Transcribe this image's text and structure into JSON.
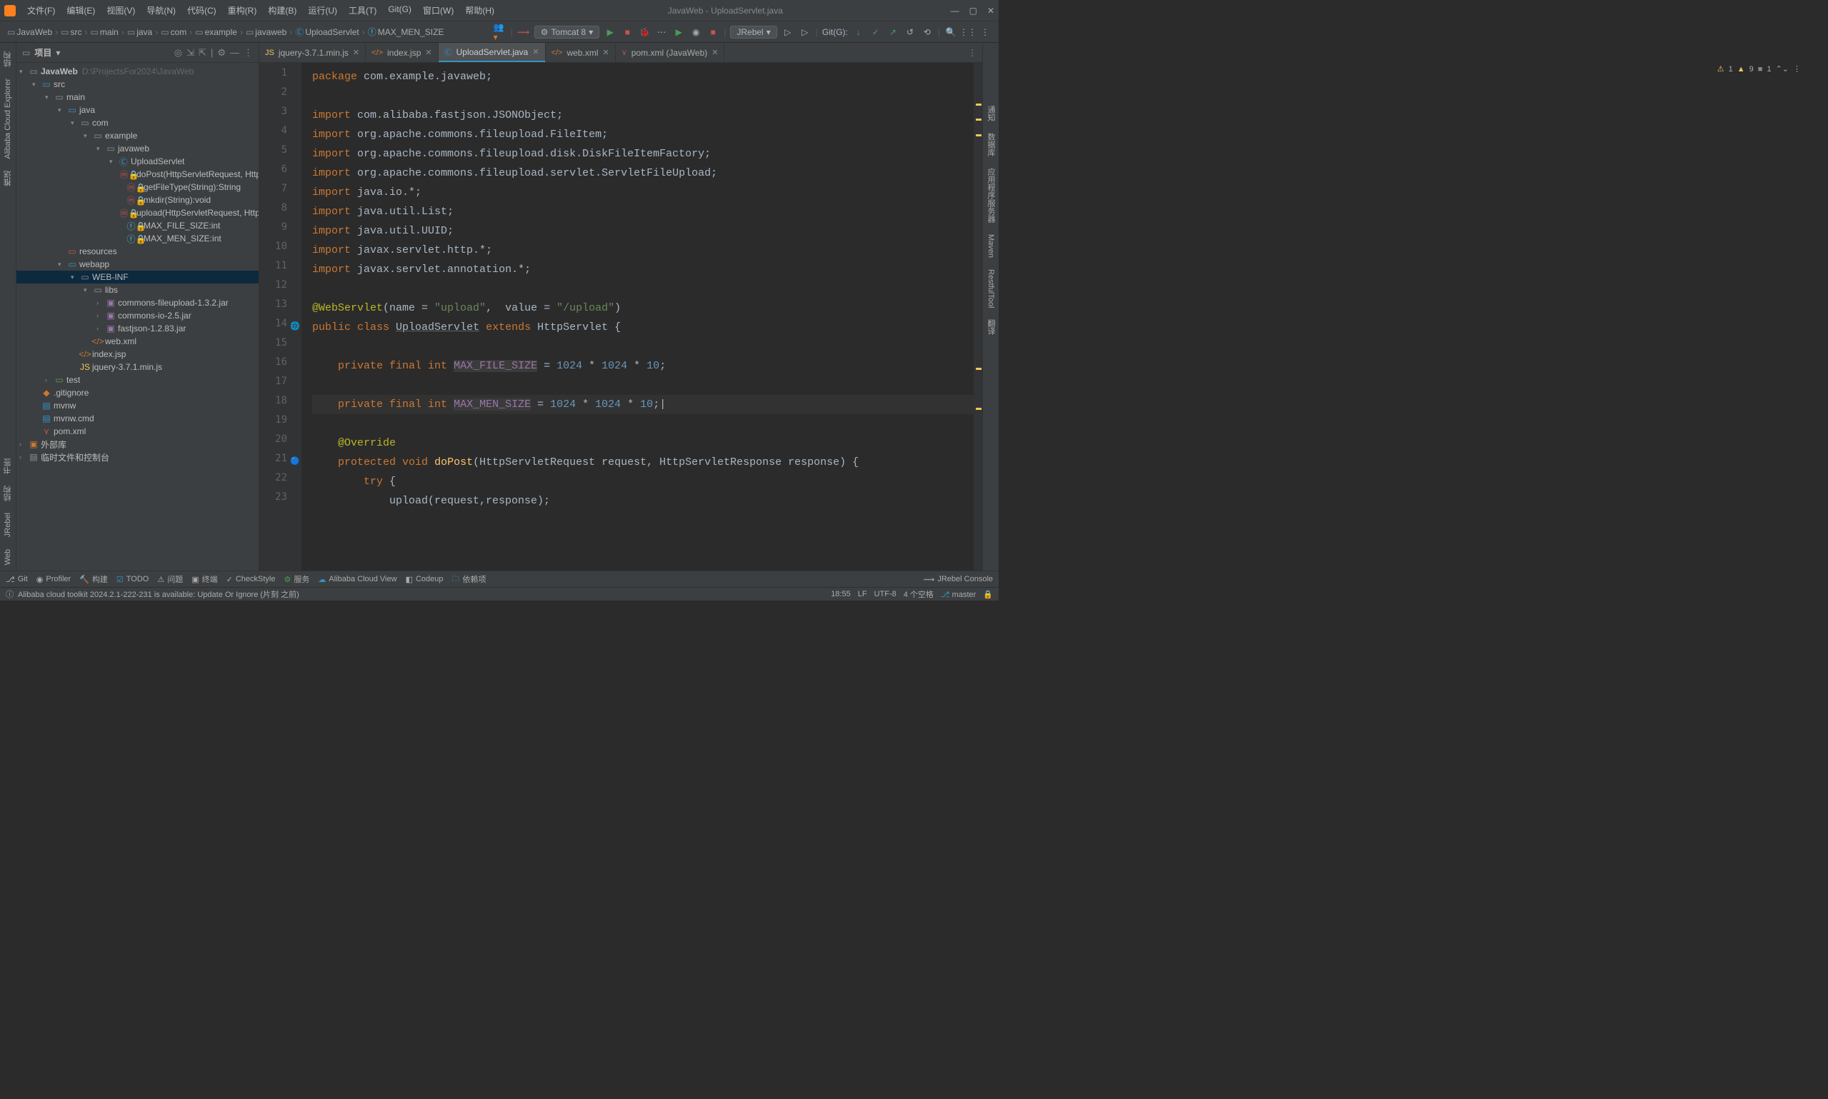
{
  "window_title": "JavaWeb - UploadServlet.java",
  "menus": [
    "文件(F)",
    "编辑(E)",
    "视图(V)",
    "导航(N)",
    "代码(C)",
    "重构(R)",
    "构建(B)",
    "运行(U)",
    "工具(T)",
    "Git(G)",
    "窗口(W)",
    "帮助(H)"
  ],
  "breadcrumb": [
    "JavaWeb",
    "src",
    "main",
    "java",
    "com",
    "example",
    "javaweb",
    "UploadServlet",
    "MAX_MEN_SIZE"
  ],
  "run_config": "Tomcat 8",
  "jrebel_label": "JRebel",
  "git_label": "Git(G):",
  "sidebar_title": "项目",
  "left_vtabs": [
    "结构",
    "Alibaba Cloud Explorer",
    "推送",
    "书签",
    "结构",
    "JRebel",
    "Web"
  ],
  "right_vtabs": [
    "通知",
    "数据库",
    "应用程序服务器",
    "Maven",
    "RestfulTool",
    "翻译"
  ],
  "project_root": "JavaWeb",
  "project_root_path": "D:\\ProjectsFor2024\\JavaWeb",
  "tree": {
    "src": "src",
    "main": "main",
    "java": "java",
    "com": "com",
    "example": "example",
    "javaweb": "javaweb",
    "UploadServlet": "UploadServlet",
    "doPost": "doPost(HttpServletRequest, HttpServ",
    "getFileType": "getFileType(String):String",
    "mkdir": "mkdir(String):void",
    "upload": "upload(HttpServletRequest, HttpServ",
    "MAX_FILE_SIZE": "MAX_FILE_SIZE:int",
    "MAX_MEN_SIZE": "MAX_MEN_SIZE:int",
    "resources": "resources",
    "webapp": "webapp",
    "WEBINF": "WEB-INF",
    "libs": "libs",
    "lib1": "commons-fileupload-1.3.2.jar",
    "lib2": "commons-io-2.5.jar",
    "lib3": "fastjson-1.2.83.jar",
    "webxml": "web.xml",
    "indexjsp": "index.jsp",
    "jquery": "jquery-3.7.1.min.js",
    "test": "test",
    "gitignore": ".gitignore",
    "mvnw": "mvnw",
    "mvnwcmd": "mvnw.cmd",
    "pomxml": "pom.xml",
    "extlib": "外部库",
    "scratch": "临时文件和控制台"
  },
  "tabs": [
    {
      "name": "jquery-3.7.1.min.js",
      "icon": "js",
      "active": false
    },
    {
      "name": "index.jsp",
      "icon": "jsp",
      "active": false
    },
    {
      "name": "UploadServlet.java",
      "icon": "class",
      "active": true
    },
    {
      "name": "web.xml",
      "icon": "xml",
      "active": false
    },
    {
      "name": "pom.xml (JavaWeb)",
      "icon": "maven",
      "active": false
    }
  ],
  "inspection": {
    "a": "1",
    "w": "9",
    "h": "1"
  },
  "code_lines": [
    {
      "n": "1",
      "h": "<span class='kw'>package</span> <span class='pkg'>com.example.javaweb</span>;"
    },
    {
      "n": "2",
      "h": ""
    },
    {
      "n": "3",
      "h": "<span class='kw'>import</span> <span class='pkg'>com.alibaba.fastjson.JSONObject</span>;"
    },
    {
      "n": "4",
      "h": "<span class='kw'>import</span> <span class='pkg'>org.apache.commons.fileupload.FileItem</span>;"
    },
    {
      "n": "5",
      "h": "<span class='kw'>import</span> <span class='pkg'>org.apache.commons.fileupload.disk.DiskFileItemFactory</span>;"
    },
    {
      "n": "6",
      "h": "<span class='kw'>import</span> <span class='pkg'>org.apache.commons.fileupload.servlet.ServletFileUpload</span>;"
    },
    {
      "n": "7",
      "h": "<span class='kw'>import</span> <span class='pkg'>java.io.*</span>;"
    },
    {
      "n": "8",
      "h": "<span class='kw'>import</span> <span class='pkg'>java.util.List</span>;"
    },
    {
      "n": "9",
      "h": "<span class='kw'>import</span> <span class='pkg'>java.util.UUID</span>;"
    },
    {
      "n": "10",
      "h": "<span class='kw'>import</span> <span class='pkg'>javax.servlet.http.*</span>;"
    },
    {
      "n": "11",
      "h": "<span class='kw'>import</span> <span class='pkg'>javax.servlet.annotation.*</span>;"
    },
    {
      "n": "12",
      "h": ""
    },
    {
      "n": "13",
      "h": "<span class='ann'>@WebServlet</span>(name = <span class='str'>\"upload\"</span>,  value = <span class='str'>\"/upload\"</span>)"
    },
    {
      "n": "14",
      "h": "<span class='kw'>public class</span> <span class='classname'>UploadServlet</span> <span class='kw'>extends</span> HttpServlet {",
      "icon": "🌐"
    },
    {
      "n": "15",
      "h": ""
    },
    {
      "n": "16",
      "h": "    <span class='kw'>private final int</span> <span class='const'>MAX_FILE_SIZE</span> = <span class='num'>1024</span> * <span class='num'>1024</span> * <span class='num'>10</span>;"
    },
    {
      "n": "17",
      "h": ""
    },
    {
      "n": "18",
      "h": "    <span class='kw'>private final int</span> <span class='const'>MAX_MEN_SIZE</span> = <span class='num'>1024</span> * <span class='num'>1024</span> * <span class='num'>10</span>;|",
      "current": true
    },
    {
      "n": "19",
      "h": ""
    },
    {
      "n": "20",
      "h": "    <span class='ann'>@Override</span>"
    },
    {
      "n": "21",
      "h": "    <span class='kw'>protected void</span> <span class='mdecl'>doPost</span>(HttpServletRequest request, HttpServletResponse response) {",
      "icon": "🔵"
    },
    {
      "n": "22",
      "h": "        <span class='kw'>try</span> {"
    },
    {
      "n": "23",
      "h": "            upload(request,response);"
    }
  ],
  "bottom_tabs": [
    "Git",
    "Profiler",
    "构建",
    "TODO",
    "问题",
    "终端",
    "CheckStyle",
    "服务",
    "Alibaba Cloud View",
    "Codeup",
    "依赖项"
  ],
  "jrebel_console": "JRebel Console",
  "status_msg": "Alibaba cloud toolkit 2024.2.1-222-231 is available: Update Or Ignore (片刻 之前)",
  "status_right": {
    "pos": "18:55",
    "lf": "LF",
    "enc": "UTF-8",
    "indent": "4 个空格",
    "branch": "master"
  }
}
